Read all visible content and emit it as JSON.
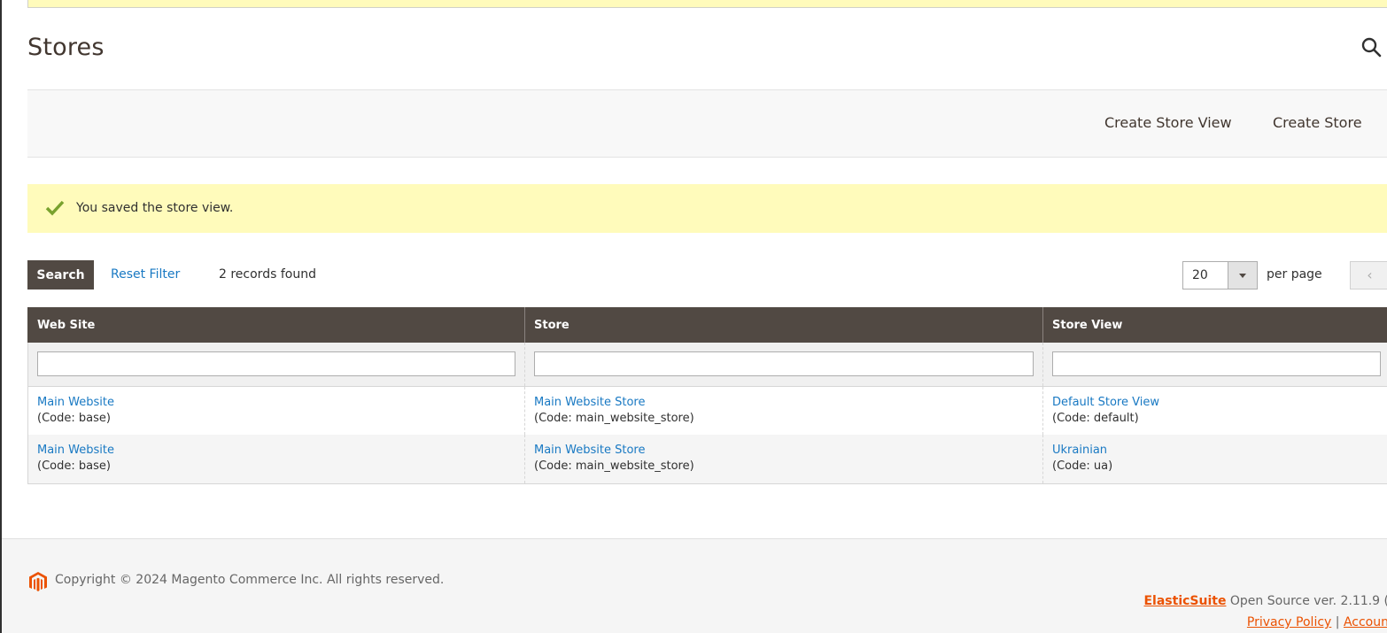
{
  "header": {
    "title": "Stores",
    "search_icon": "search-icon"
  },
  "actions": {
    "create_store_view": "Create Store View",
    "create_store": "Create Store"
  },
  "message": {
    "icon": "check-icon",
    "text": "You saved the store view."
  },
  "toolbar": {
    "search_label": "Search",
    "reset_filter_label": "Reset Filter",
    "records_found": "2 records found",
    "per_page_value": "20",
    "per_page_label": "per page",
    "prev_icon": "‹"
  },
  "grid": {
    "columns": [
      "Web Site",
      "Store",
      "Store View"
    ],
    "filters": [
      "",
      "",
      ""
    ],
    "rows": [
      {
        "website": {
          "name": "Main Website",
          "code": "(Code: base)"
        },
        "store": {
          "name": "Main Website Store",
          "code": "(Code: main_website_store)"
        },
        "store_view": {
          "name": "Default Store View",
          "code": "(Code: default)"
        }
      },
      {
        "website": {
          "name": "Main Website",
          "code": "(Code: base)"
        },
        "store": {
          "name": "Main Website Store",
          "code": "(Code: main_website_store)"
        },
        "store_view": {
          "name": "Ukrainian",
          "code": "(Code: ua)"
        }
      }
    ]
  },
  "footer": {
    "copyright": "Copyright © 2024 Magento Commerce Inc. All rights reserved.",
    "elasticsuite_link": "ElasticSuite",
    "version_text": " Open Source ver. 2.11.9 (",
    "privacy_policy": "Privacy Policy",
    "separator": " | ",
    "account_link": "Accoun"
  },
  "colors": {
    "accent": "#eb5202",
    "link": "#1979c3",
    "header_bg": "#514943",
    "message_bg": "#fffbbb",
    "success": "#79a22e"
  }
}
